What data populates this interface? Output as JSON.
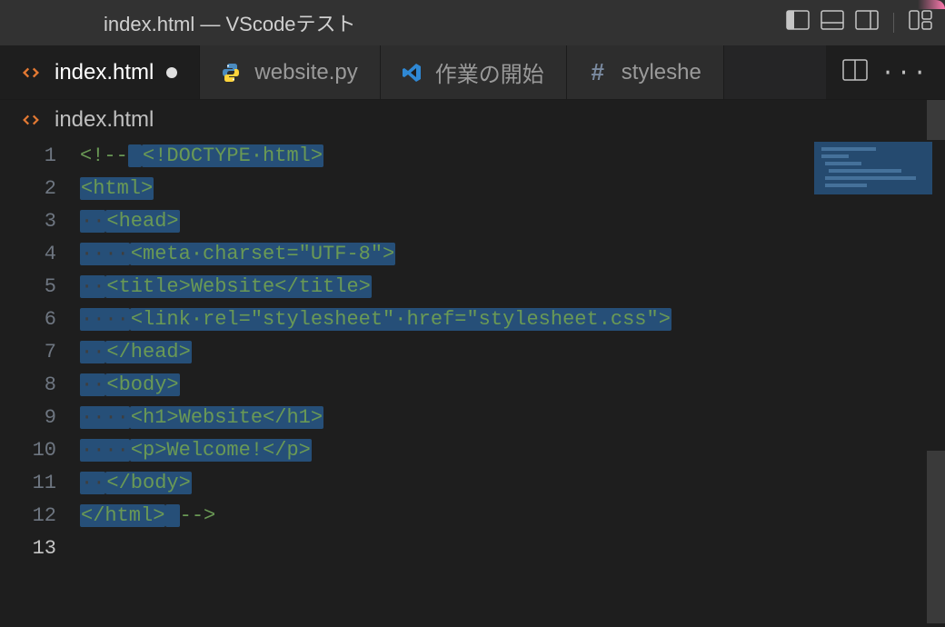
{
  "window_title": "index.html — VScodeテスト",
  "tabs": [
    {
      "label": "index.html",
      "icon": "html",
      "active": true,
      "dirty": true
    },
    {
      "label": "website.py",
      "icon": "python",
      "active": false,
      "dirty": false
    },
    {
      "label": "作業の開始",
      "icon": "vscode",
      "active": false,
      "dirty": false
    },
    {
      "label": "styleshe",
      "icon": "hash",
      "active": false,
      "dirty": false
    }
  ],
  "breadcrumb": {
    "icon": "html",
    "text": "index.html"
  },
  "gutter_lines": [
    "1",
    "2",
    "3",
    "4",
    "5",
    "6",
    "7",
    "8",
    "9",
    "10",
    "11",
    "12",
    "13"
  ],
  "gutter_current": 12,
  "code_lines": [
    {
      "segs": [
        {
          "t": "<!--",
          "cls": "t-comment",
          "sel": false
        },
        {
          "t": " ",
          "cls": "",
          "sel": true
        },
        {
          "t": "<!DOCTYPE·html>",
          "cls": "t-comment",
          "sel": true
        }
      ]
    },
    {
      "segs": [
        {
          "t": "<html>",
          "cls": "t-comment",
          "sel": true
        }
      ]
    },
    {
      "segs": [
        {
          "t": "··",
          "cls": "t-ws",
          "sel": true
        },
        {
          "t": "<head>",
          "cls": "t-comment",
          "sel": true
        }
      ]
    },
    {
      "segs": [
        {
          "t": "····",
          "cls": "t-ws",
          "sel": true
        },
        {
          "t": "<meta·charset=\"UTF-8\">",
          "cls": "t-comment",
          "sel": true
        }
      ]
    },
    {
      "segs": [
        {
          "t": "··",
          "cls": "t-ws",
          "sel": true
        },
        {
          "t": "<title>Website</title>",
          "cls": "t-comment",
          "sel": true
        }
      ]
    },
    {
      "segs": [
        {
          "t": "····",
          "cls": "t-ws",
          "sel": true
        },
        {
          "t": "<link·rel=\"stylesheet\"·href=\"stylesheet.css\">",
          "cls": "t-comment",
          "sel": true
        }
      ]
    },
    {
      "segs": [
        {
          "t": "··",
          "cls": "t-ws",
          "sel": true
        },
        {
          "t": "</head>",
          "cls": "t-comment",
          "sel": true
        }
      ]
    },
    {
      "segs": [
        {
          "t": "··",
          "cls": "t-ws",
          "sel": true
        },
        {
          "t": "<body>",
          "cls": "t-comment",
          "sel": true
        }
      ]
    },
    {
      "segs": [
        {
          "t": "····",
          "cls": "t-ws",
          "sel": true
        },
        {
          "t": "<h1>Website</h1>",
          "cls": "t-comment",
          "sel": true
        }
      ]
    },
    {
      "segs": [
        {
          "t": "····",
          "cls": "t-ws",
          "sel": true
        },
        {
          "t": "<p>Welcome!</p>",
          "cls": "t-comment",
          "sel": true
        }
      ]
    },
    {
      "segs": [
        {
          "t": "··",
          "cls": "t-ws",
          "sel": true
        },
        {
          "t": "</body>",
          "cls": "t-comment",
          "sel": true
        }
      ]
    },
    {
      "segs": [
        {
          "t": "</html>",
          "cls": "t-comment",
          "sel": true
        },
        {
          "t": " ",
          "cls": "",
          "sel": true
        },
        {
          "t": "-->",
          "cls": "t-comment",
          "sel": false
        }
      ]
    },
    {
      "segs": []
    }
  ]
}
